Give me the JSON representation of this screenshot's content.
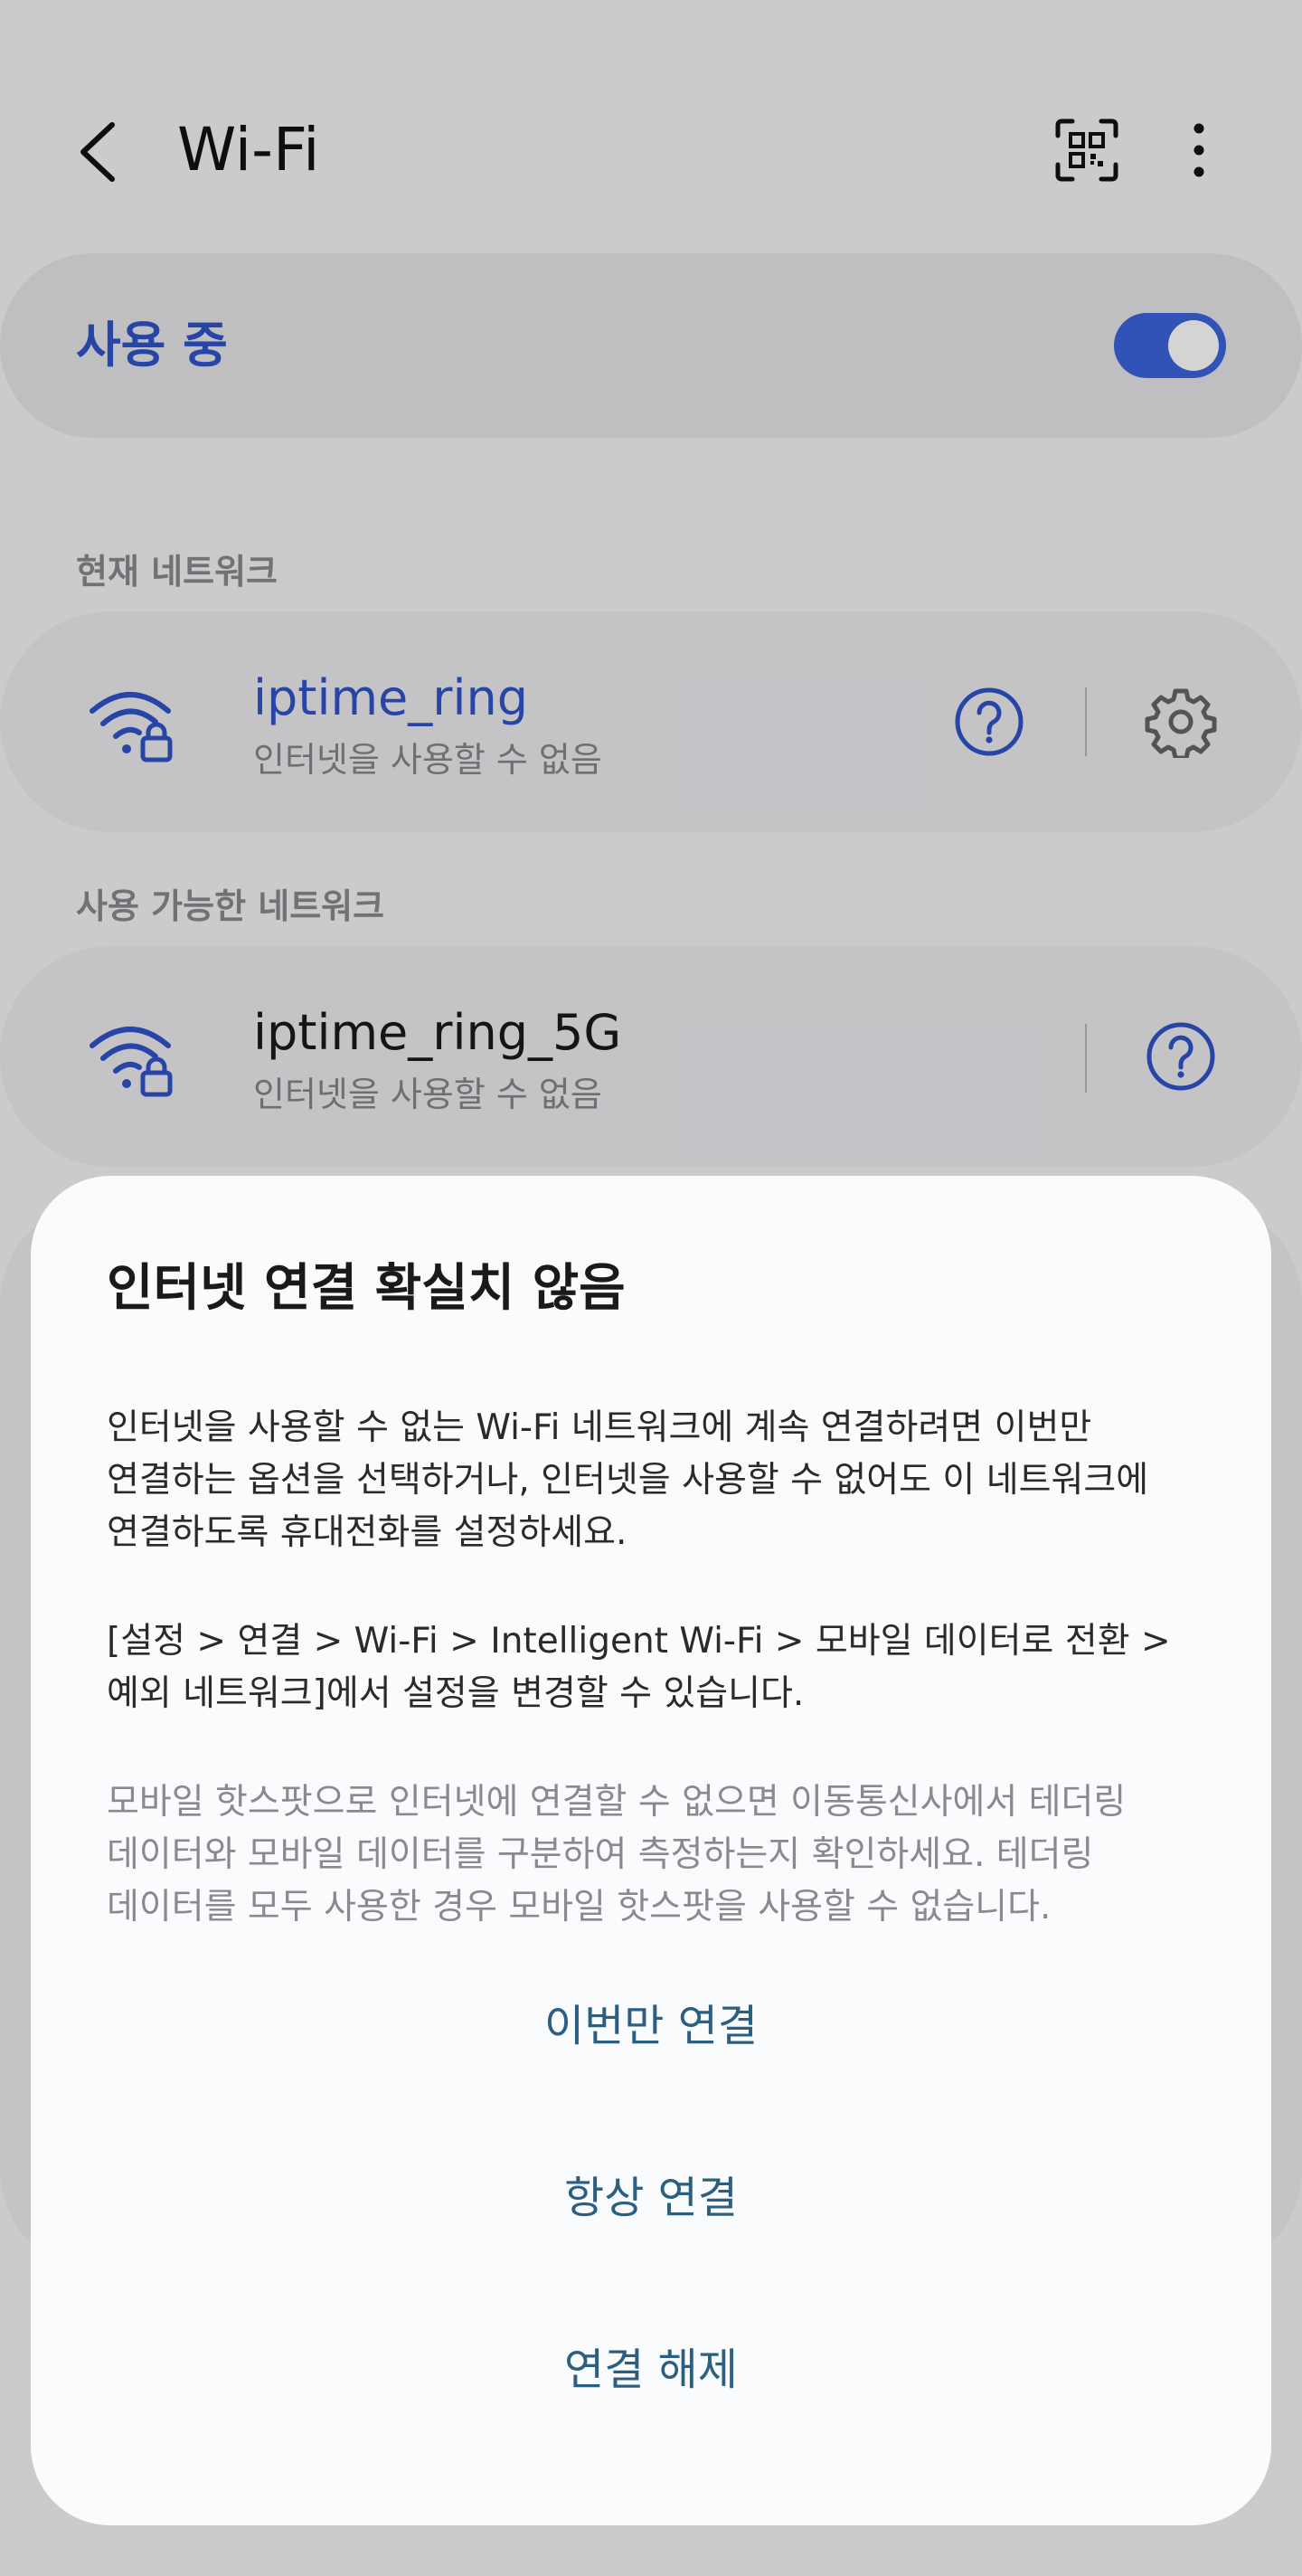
{
  "header": {
    "title": "Wi-Fi",
    "back_icon": "chevron-left-icon",
    "qr_icon": "qr-code-scan-icon",
    "more_icon": "more-vertical-icon"
  },
  "master_toggle": {
    "label": "사용 중",
    "on": true
  },
  "current_network": {
    "section_title": "현재 네트워크",
    "name": "iptime_ring",
    "status": "인터넷을 사용할 수 없음",
    "icons": [
      "wifi-lock-icon",
      "help-icon",
      "gear-icon"
    ]
  },
  "available_networks": {
    "section_title": "사용 가능한 네트워크",
    "items": [
      {
        "name": "iptime_ring_5G",
        "status": "인터넷을 사용할 수 없음",
        "icons": [
          "wifi-lock-icon",
          "help-icon"
        ]
      }
    ]
  },
  "dialog": {
    "title": "인터넷 연결 확실치 않음",
    "paragraph1": "인터넷을 사용할 수 없는 Wi-Fi 네트워크에 계속 연결하려면 이번만\n연결하는 옵션을 선택하거나, 인터넷을 사용할 수 없어도 이 네트워크에\n연결하도록 휴대전화를 설정하세요.",
    "paragraph2": "[설정 > 연결 > Wi-Fi > Intelligent Wi-Fi > 모바일 데이터로 전환 >\n예외 네트워크]에서 설정을 변경할 수 있습니다.",
    "paragraph3": "모바일 핫스팟으로 인터넷에 연결할 수 없으면 이동통신사에서 테더링\n데이터와 모바일 데이터를 구분하여 측정하는지 확인하세요. 테더링\n데이터를 모두 사용한 경우 모바일 핫스팟을 사용할 수 없습니다.",
    "buttons": [
      "이번만 연결",
      "항상 연결",
      "연결 해제"
    ]
  },
  "colors": {
    "accent": "#3c64dc",
    "dialog_button": "#2b5f82"
  }
}
